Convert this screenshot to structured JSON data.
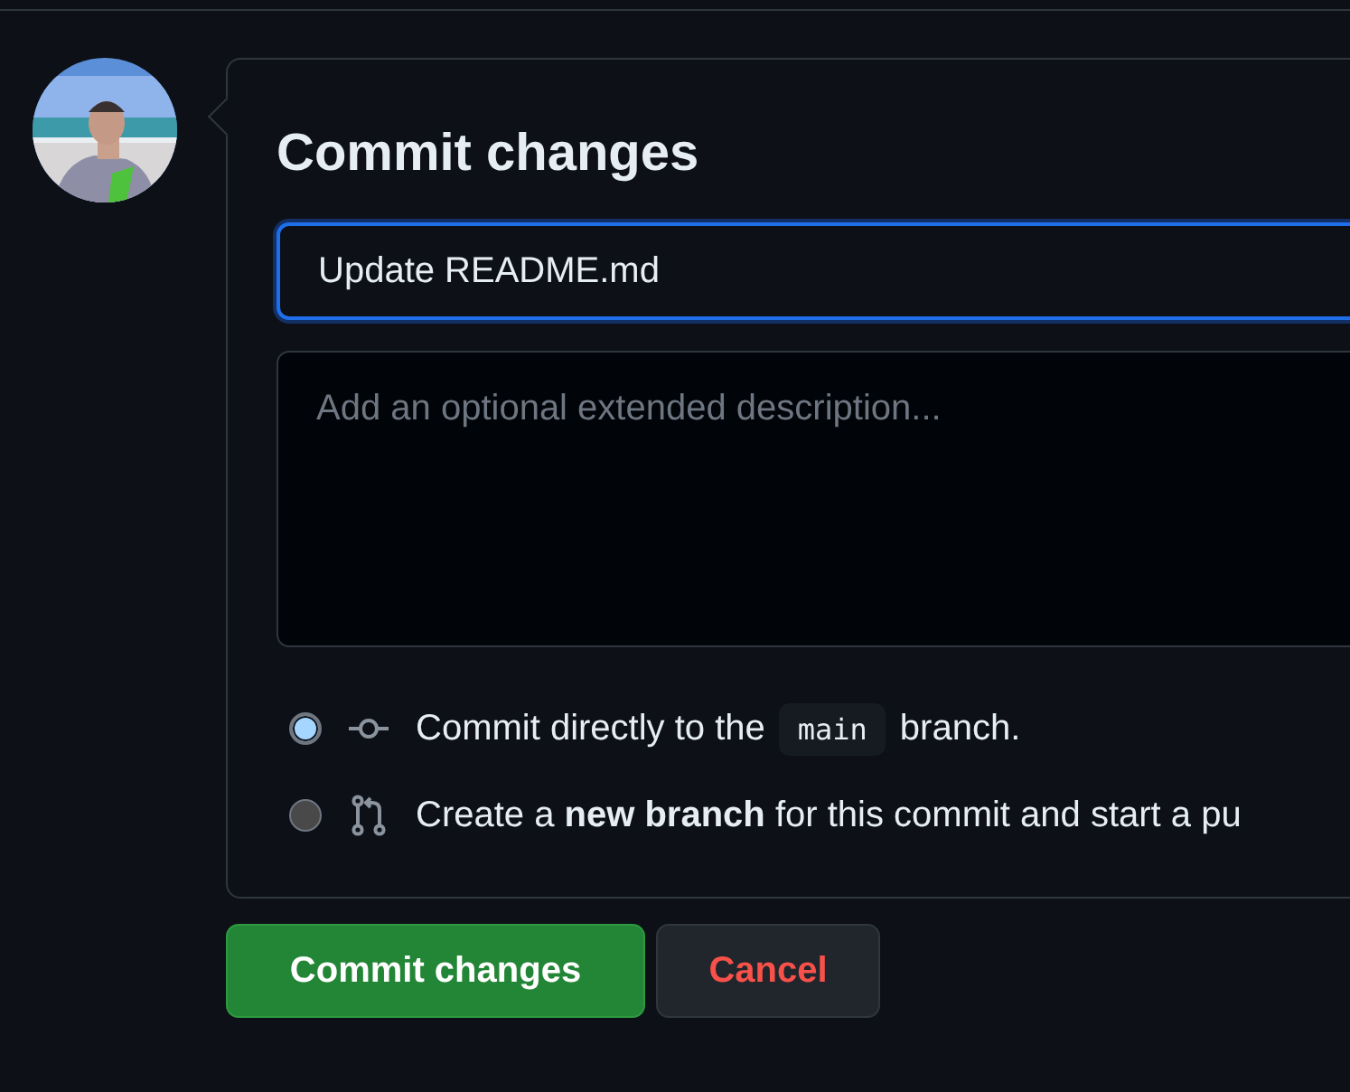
{
  "title": "Commit changes",
  "summary": {
    "value": "Update README.md",
    "focused": true
  },
  "description": {
    "placeholder": "Add an optional extended description..."
  },
  "options": [
    {
      "kind": "direct",
      "selected": true,
      "text_before": "Commit directly to the",
      "branch": "main",
      "text_after": "branch."
    },
    {
      "kind": "new-branch",
      "selected": false,
      "text": "Create a **new branch** for this commit and start a pu"
    }
  ],
  "buttons": [
    {
      "kind": "primary",
      "label": "Commit changes"
    },
    {
      "kind": "danger",
      "label": "Cancel"
    }
  ]
}
